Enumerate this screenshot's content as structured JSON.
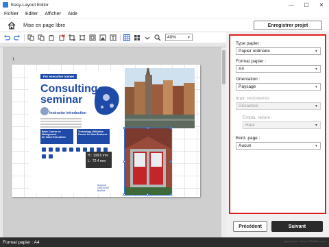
{
  "window": {
    "title": "Easy-Layout Editor",
    "minimize": "—",
    "maximize": "☐",
    "close": "✕"
  },
  "menu": {
    "items": [
      "Fichier",
      "Editer",
      "Afficher",
      "Aide"
    ]
  },
  "header": {
    "mode_label": "Mise en page libre",
    "save_button": "Enregistrer projet"
  },
  "toolbar": {
    "zoom_value": "40%"
  },
  "canvas": {
    "page_number": "1",
    "selection_size": {
      "height": "H : 108.6 mm",
      "width": "L : 72.4 mm"
    }
  },
  "brochure": {
    "tag": "For executive trainee",
    "headline_line1": "Consulting",
    "headline_line2": "seminar",
    "intro": "Instructor introduction",
    "box1_title": "Basic Course on Management",
    "box1_sub": "for future Executives",
    "box2_title": "Technology Utilization",
    "box2_sub": "Course for New Business",
    "logo1": "Sunpost",
    "logo2": "GREEONY",
    "logo3": "BioRex"
  },
  "properties": {
    "paper_type": {
      "label": "Type papier :",
      "value": "Papier ordinaire"
    },
    "paper_format": {
      "label": "Format papier :",
      "value": "A4"
    },
    "orientation": {
      "label": "Orientation :",
      "value": "Paysage"
    },
    "duplex": {
      "label": "Impr. recto/verso :",
      "value": "Désactivé"
    },
    "binding": {
      "label": "Empla. reliure :",
      "value": "Haut"
    },
    "borders": {
      "label": "Bord. page :",
      "value": "Aucun"
    }
  },
  "nav": {
    "prev": "Précédent",
    "next": "Suivant"
  },
  "status": {
    "text": "Format papier : A4",
    "copyright": "Imprimante : Canon TS8000 series"
  },
  "colors": {
    "accent": "#1e4aa8",
    "highlight": "#e31b1b",
    "selection": "#2e6fd9"
  }
}
